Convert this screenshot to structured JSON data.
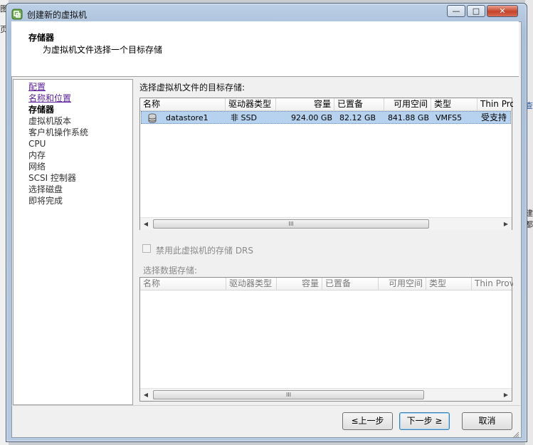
{
  "background": {
    "left_text_1": "图",
    "left_text_2": "页",
    "right_text_1": "查",
    "right_text_2": "建都"
  },
  "window": {
    "title": "创建新的虚拟机",
    "min_label": "—",
    "max_label": "□",
    "close_label": "✕"
  },
  "header": {
    "title": "存储器",
    "subtitle": "为虚拟机文件选择一个目标存储"
  },
  "nav": {
    "items": [
      {
        "label": "配置",
        "state": "link"
      },
      {
        "label": "名称和位置",
        "state": "link"
      },
      {
        "label": "存储器",
        "state": "current"
      },
      {
        "label": "虚拟机版本",
        "state": "normal"
      },
      {
        "label": "客户机操作系统",
        "state": "normal"
      },
      {
        "label": "CPU",
        "state": "normal"
      },
      {
        "label": "内存",
        "state": "normal"
      },
      {
        "label": "网络",
        "state": "normal"
      },
      {
        "label": "SCSI 控制器",
        "state": "normal"
      },
      {
        "label": "选择磁盘",
        "state": "normal"
      },
      {
        "label": "即将完成",
        "state": "normal"
      }
    ]
  },
  "target_storage": {
    "label": "选择虚拟机文件的目标存储:",
    "columns": [
      "名称",
      "驱动器类型",
      "容量",
      "已置备",
      "可用空间",
      "类型",
      "Thin Prov"
    ],
    "rows": [
      {
        "name": "datastore1",
        "drive_type": "非 SSD",
        "capacity": "924.00 GB",
        "provisioned": "82.12 GB",
        "free": "841.88 GB",
        "type": "VMFS5",
        "thin": "受支持"
      }
    ]
  },
  "drs": {
    "label": "禁用此虚拟机的存储 DRS",
    "checked": false
  },
  "datastore_select": {
    "label": "选择数据存储:",
    "columns": [
      "名称",
      "驱动器类型",
      "容量",
      "已置备",
      "可用空间",
      "类型",
      "Thin Provi"
    ]
  },
  "scroll_arrows": {
    "left": "◀",
    "right": "▶",
    "thumb": "III"
  },
  "buttons": {
    "back": "≤上一步",
    "next": "下一步 ≥",
    "cancel": "取消"
  },
  "colors": {
    "selected_row": "#b7d2ee",
    "close_button": "#c5432b",
    "link": "#5b1f9a"
  }
}
